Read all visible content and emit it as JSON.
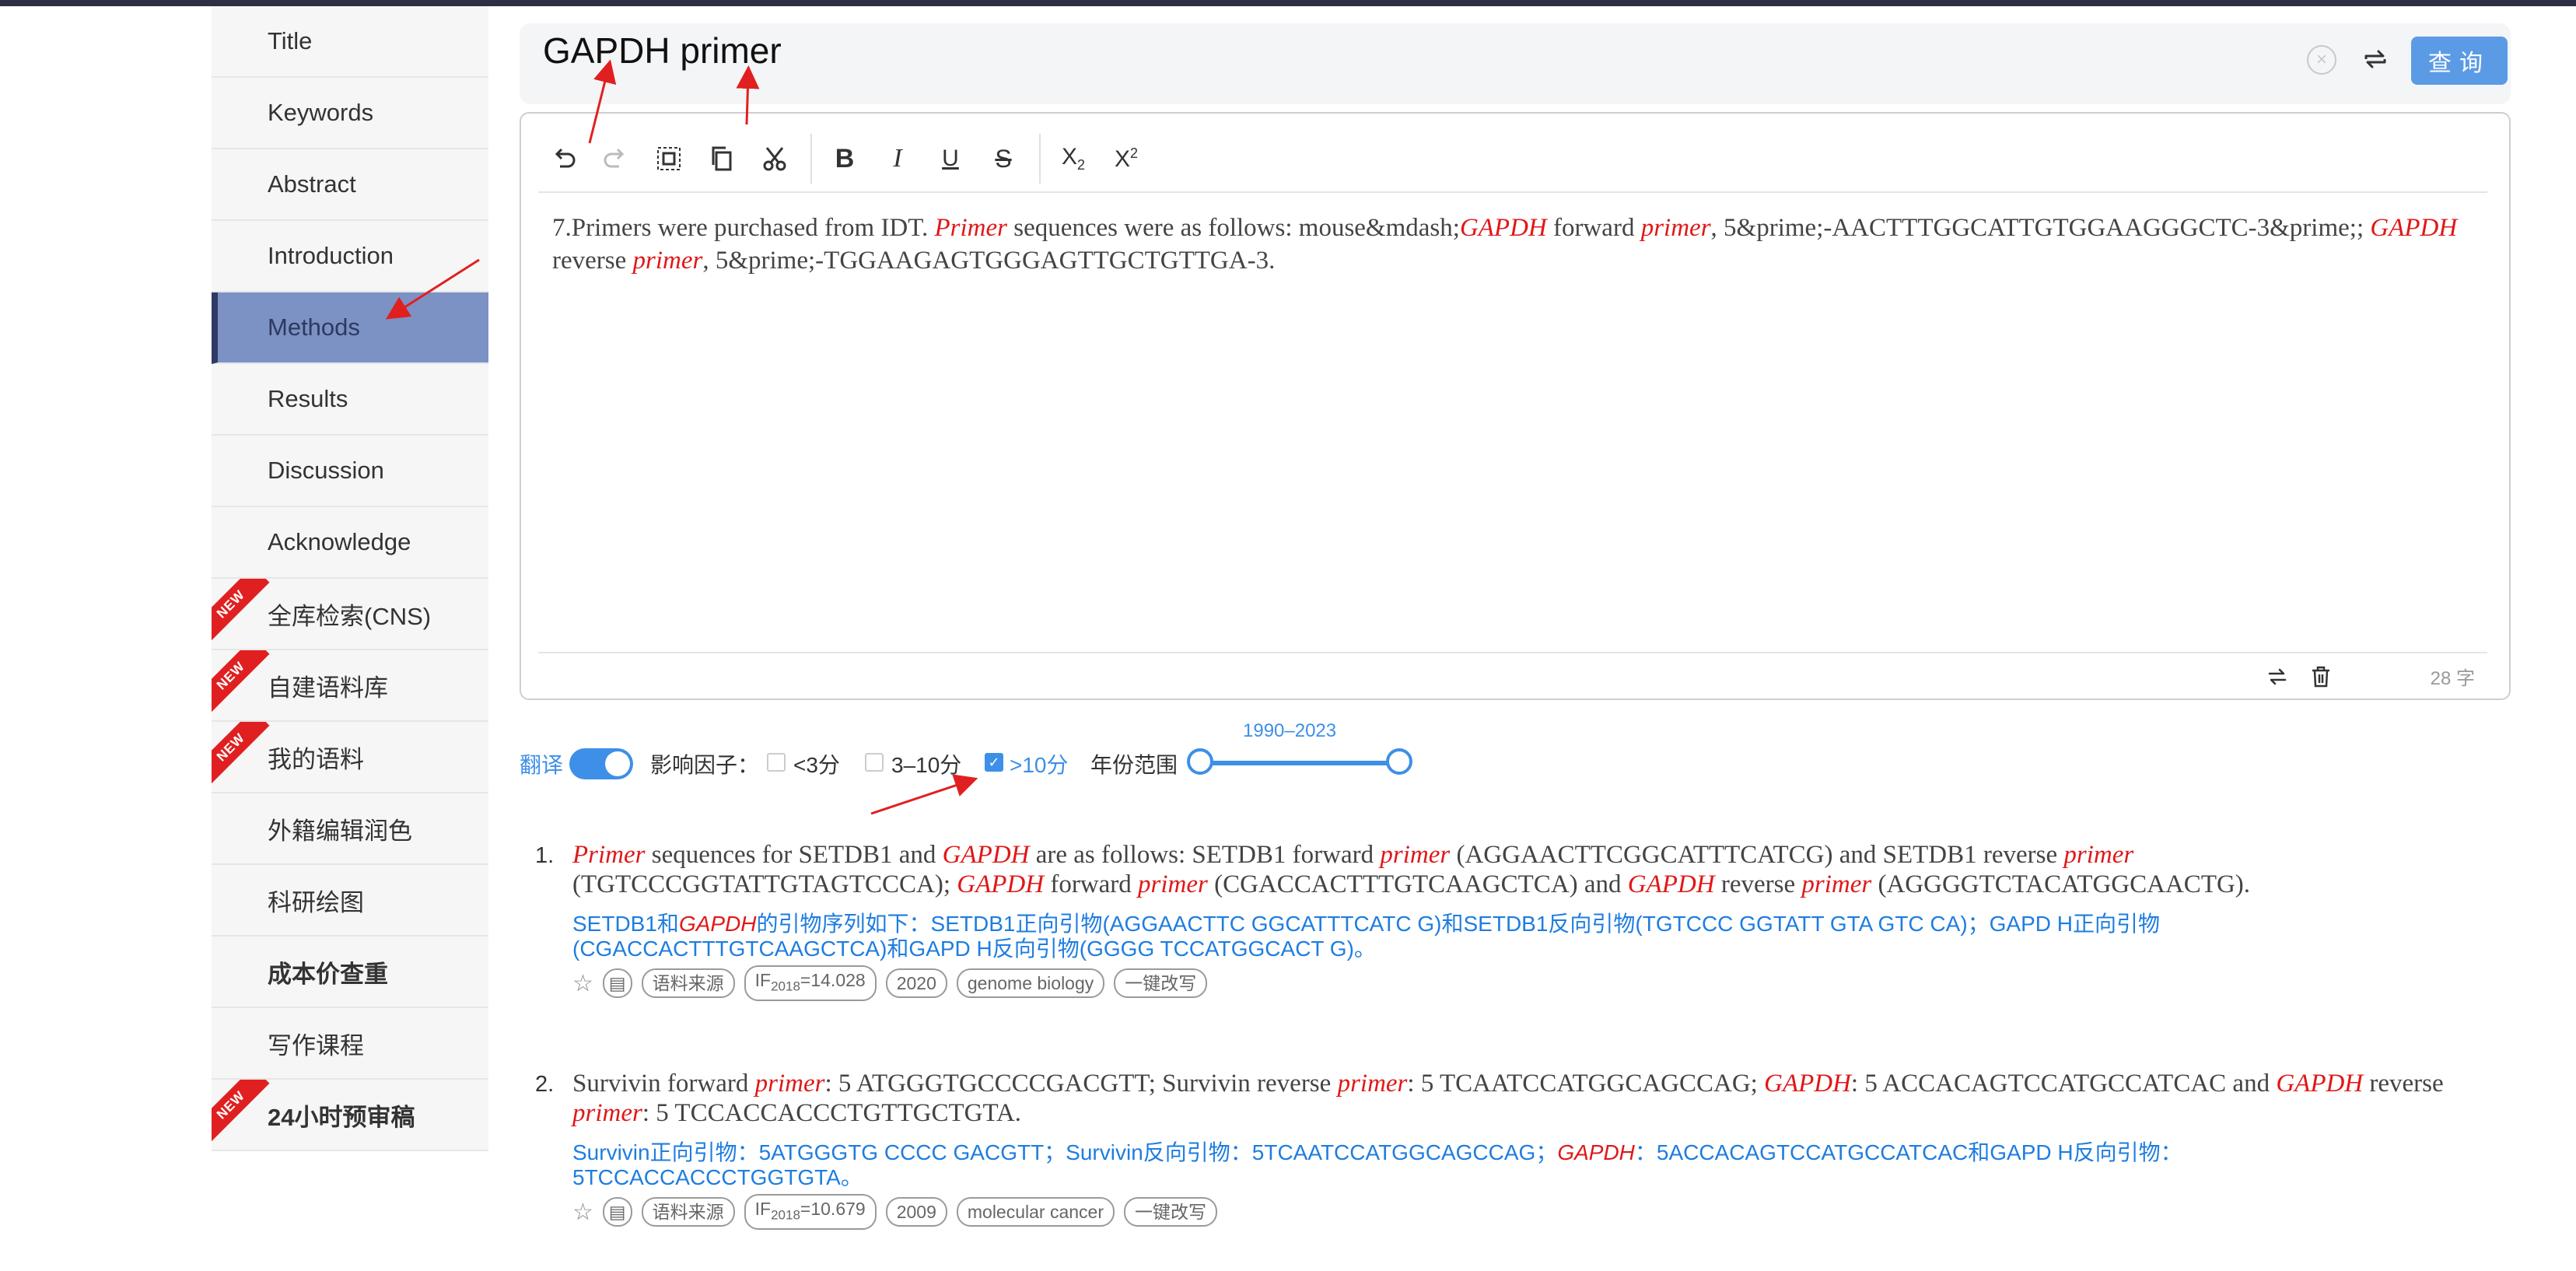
{
  "sidebar": {
    "items": [
      {
        "label": "Title",
        "new": false,
        "active": false,
        "bold": false
      },
      {
        "label": "Keywords",
        "new": false,
        "active": false,
        "bold": false
      },
      {
        "label": "Abstract",
        "new": false,
        "active": false,
        "bold": false
      },
      {
        "label": "Introduction",
        "new": false,
        "active": false,
        "bold": false
      },
      {
        "label": "Methods",
        "new": false,
        "active": true,
        "bold": false
      },
      {
        "label": "Results",
        "new": false,
        "active": false,
        "bold": false
      },
      {
        "label": "Discussion",
        "new": false,
        "active": false,
        "bold": false
      },
      {
        "label": "Acknowledge",
        "new": false,
        "active": false,
        "bold": false
      },
      {
        "label": "全库检索(CNS)",
        "new": true,
        "active": false,
        "bold": false
      },
      {
        "label": "自建语料库",
        "new": true,
        "active": false,
        "bold": false
      },
      {
        "label": "我的语料",
        "new": true,
        "active": false,
        "bold": false
      },
      {
        "label": "外籍编辑润色",
        "new": false,
        "active": false,
        "bold": false
      },
      {
        "label": "科研绘图",
        "new": false,
        "active": false,
        "bold": false
      },
      {
        "label": "成本价查重",
        "new": false,
        "active": false,
        "bold": true
      },
      {
        "label": "写作课程",
        "new": false,
        "active": false,
        "bold": false
      },
      {
        "label": "24小时预审稿",
        "new": true,
        "active": false,
        "bold": true
      }
    ],
    "new_badge": "NEW"
  },
  "search": {
    "query": "GAPDH primer",
    "query_button": "查询"
  },
  "editor": {
    "segments": [
      {
        "t": "7.Primers were purchased from IDT. ",
        "h": false
      },
      {
        "t": "Primer",
        "h": true
      },
      {
        "t": " sequences were as follows: mouse&mdash;",
        "h": false
      },
      {
        "t": "GAPDH",
        "h": true
      },
      {
        "t": " forward ",
        "h": false
      },
      {
        "t": "primer",
        "h": true
      },
      {
        "t": ", 5&prime;-AACTTTGGCATTGTGGAAGGGCTC-3&prime;; ",
        "h": false
      },
      {
        "t": "GAPDH",
        "h": true
      },
      {
        "t": " reverse ",
        "h": false
      },
      {
        "t": "primer",
        "h": true
      },
      {
        "t": ", 5&prime;-TGGAAGAGTGGGAGTTGCTGTTGA-3.",
        "h": false
      }
    ],
    "char_count": "28 字"
  },
  "filters": {
    "translate_label": "翻译",
    "translate_on": true,
    "impact_label": "影响因子：",
    "options": [
      {
        "label": "<3分",
        "checked": false
      },
      {
        "label": "3–10分",
        "checked": false
      },
      {
        "label": ">10分",
        "checked": true
      }
    ],
    "year_label": "年份范围",
    "year_range": "1990–2023"
  },
  "results": [
    {
      "num": "1.",
      "en": [
        {
          "t": "Primer",
          "h": true
        },
        {
          "t": " sequences for SETDB1 and ",
          "h": false
        },
        {
          "t": "GAPDH",
          "h": true
        },
        {
          "t": " are as follows: SETDB1 forward ",
          "h": false
        },
        {
          "t": "primer",
          "h": true
        },
        {
          "t": " (AGGAACTTCGGCATTTCATCG) and SETDB1 reverse ",
          "h": false
        },
        {
          "t": "primer",
          "h": true
        },
        {
          "t": " (TGTCCCGGTATTGTAGTCCCA); ",
          "h": false
        },
        {
          "t": "GAPDH",
          "h": true
        },
        {
          "t": " forward ",
          "h": false
        },
        {
          "t": "primer",
          "h": true
        },
        {
          "t": " (CGACCACTTTGTCAAGCTCA) and ",
          "h": false
        },
        {
          "t": "GAPDH",
          "h": true
        },
        {
          "t": " reverse ",
          "h": false
        },
        {
          "t": "primer",
          "h": true
        },
        {
          "t": " (AGGGGTCTACATGGCAACTG).",
          "h": false
        }
      ],
      "zh": [
        {
          "t": "SETDB1和",
          "h": false
        },
        {
          "t": "GAPDH",
          "h": true
        },
        {
          "t": "的引物序列如下：SETDB1正向引物(AGGAACTTC GGCATTTCATC G)和SETDB1反向引物(TGTCCC GGTATT GTA GTC CA)；GAPD H正向引物(CGACCACTTTGTCAAGCTCA)和GAPD H反向引物(GGGG TCCATGGCACT G)。",
          "h": false
        }
      ],
      "source_label": "语料来源",
      "if_prefix": "IF",
      "if_year": "2018",
      "if_value": "=14.028",
      "year": "2020",
      "journal": "genome biology",
      "rewrite": "一键改写"
    },
    {
      "num": "2.",
      "en": [
        {
          "t": "Survivin forward ",
          "h": false
        },
        {
          "t": "primer",
          "h": true
        },
        {
          "t": ": 5 ATGGGTGCCCCGACGTT; Survivin reverse ",
          "h": false
        },
        {
          "t": "primer",
          "h": true
        },
        {
          "t": ": 5 TCAATCCATGGCAGCCAG; ",
          "h": false
        },
        {
          "t": "GAPDH",
          "h": true
        },
        {
          "t": ": 5 ACCACAGTCCATGCCATCAC and ",
          "h": false
        },
        {
          "t": "GAPDH",
          "h": true
        },
        {
          "t": " reverse ",
          "h": false
        },
        {
          "t": "primer",
          "h": true
        },
        {
          "t": ": 5 TCCACCACCCTGTTGCTGTA.",
          "h": false
        }
      ],
      "zh": [
        {
          "t": "Survivin正向引物：5ATGGGTG CCCC GACGTT；Survivin反向引物：5TCAATCCATGGCAGCCAG；",
          "h": false
        },
        {
          "t": "GAPDH",
          "h": true
        },
        {
          "t": "：5ACCACAGTCCATGCCATCAC和GAPD H反向引物：5TCCACCACCCTGGTGTA。",
          "h": false
        }
      ],
      "source_label": "语料来源",
      "if_prefix": "IF",
      "if_year": "2018",
      "if_value": "=10.679",
      "year": "2009",
      "journal": "molecular cancer",
      "rewrite": "一键改写"
    }
  ],
  "colors": {
    "accent": "#3d8fe8",
    "highlight": "#e01818",
    "sidebar_active": "#7c91c4",
    "annotation_arrow": "#e02020"
  }
}
